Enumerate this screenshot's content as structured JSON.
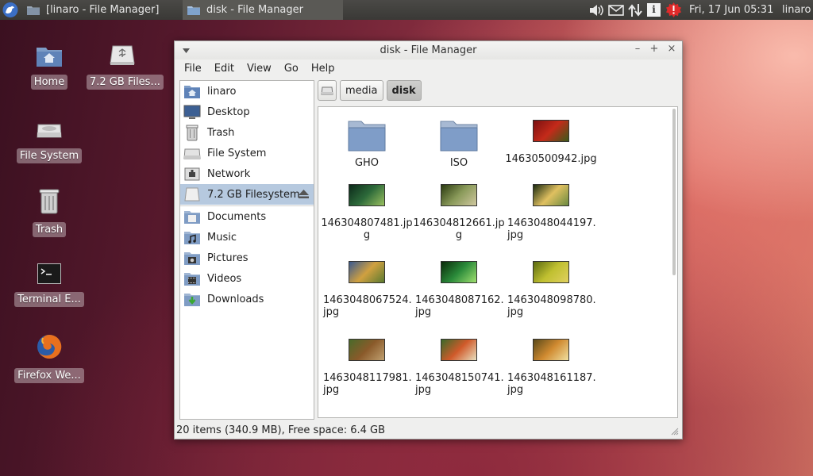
{
  "panel": {
    "task1": "[linaro - File Manager]",
    "task2": "disk - File Manager",
    "clock": "Fri, 17 Jun  05:31",
    "user": "linaro",
    "info_glyph": "i"
  },
  "desktop": {
    "icons": [
      {
        "label": "Home"
      },
      {
        "label": "7.2 GB Files..."
      },
      {
        "label": "File System"
      },
      {
        "label": "Trash"
      },
      {
        "label": "Terminal E..."
      },
      {
        "label": "Firefox We..."
      }
    ]
  },
  "window": {
    "title": "disk - File Manager",
    "controls": {
      "minimize": "–",
      "maximize": "+",
      "close": "×"
    },
    "menu": [
      "File",
      "Edit",
      "View",
      "Go",
      "Help"
    ],
    "sidebar": [
      {
        "label": "linaro",
        "icon": "home-icon"
      },
      {
        "label": "Desktop",
        "icon": "desktop-icon"
      },
      {
        "label": "Trash",
        "icon": "trash-icon"
      },
      {
        "label": "File System",
        "icon": "drive-icon"
      },
      {
        "label": "Network",
        "icon": "network-icon"
      },
      {
        "label": "7.2 GB Filesystem",
        "icon": "usb-drive-icon",
        "active": true
      },
      {
        "label": "Documents",
        "icon": "folder-icon"
      },
      {
        "label": "Music",
        "icon": "folder-music-icon"
      },
      {
        "label": "Pictures",
        "icon": "folder-pictures-icon"
      },
      {
        "label": "Videos",
        "icon": "folder-videos-icon"
      },
      {
        "label": "Downloads",
        "icon": "folder-downloads-icon"
      }
    ],
    "path": [
      "media",
      "disk"
    ],
    "files": [
      {
        "name": "GHO",
        "type": "folder"
      },
      {
        "name": "ISO",
        "type": "folder"
      },
      {
        "name": "14630500942.jpg",
        "type": "image",
        "colors": [
          "#7a1010",
          "#c42a1a",
          "#3a5a1a"
        ]
      },
      {
        "name": "146304807481.jpg",
        "type": "image",
        "colors": [
          "#0c2a1a",
          "#2d6a3a",
          "#9ac060"
        ]
      },
      {
        "name": "146304812661.jpg",
        "type": "image",
        "colors": [
          "#2a3a10",
          "#8a9a5a",
          "#d0c8a0"
        ]
      },
      {
        "name": "1463048044197.jpg",
        "type": "image",
        "colors": [
          "#1a2a10",
          "#e0c060",
          "#6a8a40"
        ]
      },
      {
        "name": "1463048067524.jpg",
        "type": "image",
        "colors": [
          "#3a5a90",
          "#d0a040",
          "#5a7a30"
        ]
      },
      {
        "name": "1463048087162.jpg",
        "type": "image",
        "colors": [
          "#0a2a0a",
          "#2a8a3a",
          "#a0e070"
        ]
      },
      {
        "name": "1463048098780.jpg",
        "type": "image",
        "colors": [
          "#5a6a10",
          "#c0c030",
          "#e0d060"
        ]
      },
      {
        "name": "1463048117981.jpg",
        "type": "image",
        "colors": [
          "#4a6a2a",
          "#8a5a2a",
          "#c0a070"
        ]
      },
      {
        "name": "1463048150741.jpg",
        "type": "image",
        "colors": [
          "#3a6a2a",
          "#d05a2a",
          "#e8e0c0"
        ]
      },
      {
        "name": "1463048161187.jpg",
        "type": "image",
        "colors": [
          "#5a4a1a",
          "#d08a30",
          "#f0e0a0"
        ]
      }
    ],
    "status": "20 items (340.9 MB), Free space: 6.4 GB"
  }
}
